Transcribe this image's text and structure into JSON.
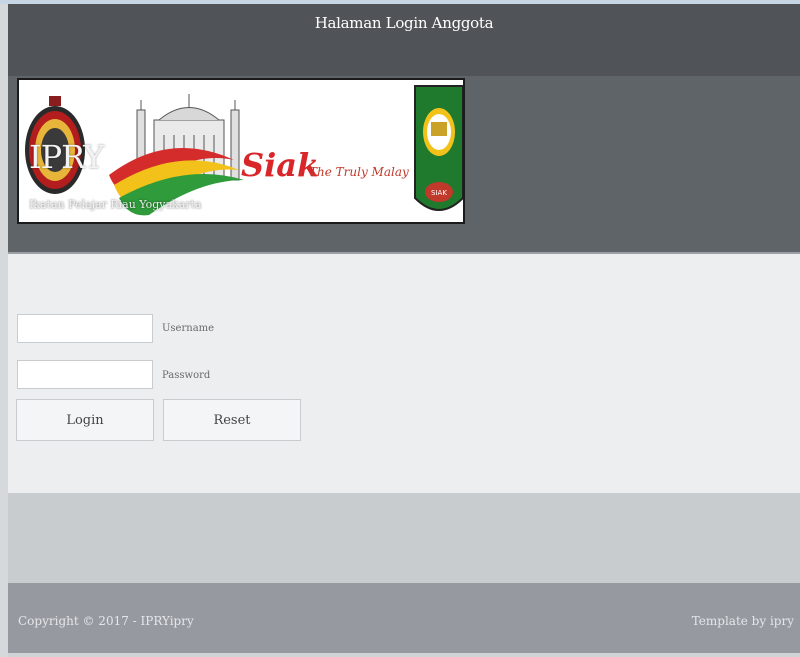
{
  "header": {
    "title": "Halaman Login Anggota"
  },
  "banner": {
    "site_title": "IPRY",
    "site_subtitle": "Ikatan Pelajar Riau Yogyakarta",
    "slogan_main": "Siak",
    "slogan_tagline": "The Truly Malay",
    "emblem_text": "SIAK"
  },
  "login_form": {
    "username_value": "",
    "username_label": "Username",
    "password_value": "",
    "password_label": "Password",
    "login_label": "Login",
    "reset_label": "Reset"
  },
  "footer": {
    "copyright": "Copyright © 2017 - IPRYipry",
    "credit": "Template by ipry"
  },
  "colors": {
    "header_bg": "#505458",
    "banner_bg": "#5f6469",
    "content_bg": "#eceef0",
    "footer_bg": "#969aa0",
    "slogan_red": "#d8262a",
    "emblem_green": "#1f7a2e",
    "ribbon_yellow": "#f2c21b"
  }
}
